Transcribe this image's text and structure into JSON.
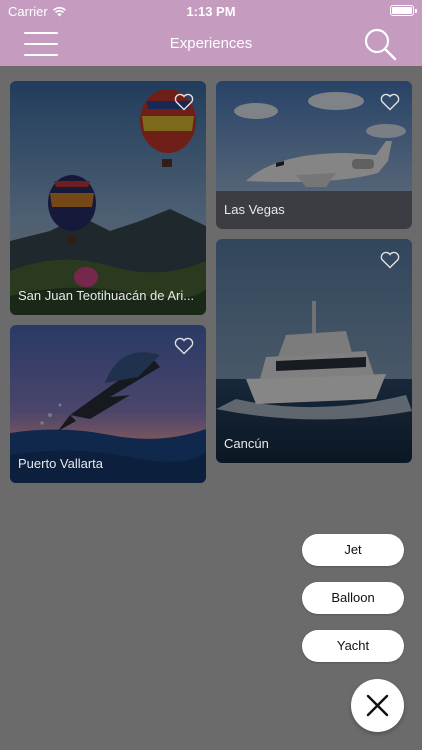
{
  "status_bar": {
    "carrier": "Carrier",
    "time": "1:13 PM"
  },
  "nav": {
    "title": "Experiences",
    "menu_icon": "hamburger-menu-icon",
    "search_icon": "search-icon"
  },
  "cards": [
    {
      "label": "San Juan Teotihuacán de Ari...",
      "image": "hot-air-balloons"
    },
    {
      "label": "Las Vegas",
      "image": "private-jet"
    },
    {
      "label": "Cancún",
      "image": "yacht"
    },
    {
      "label": "Puerto Vallarta",
      "image": "sailfish"
    }
  ],
  "filter_menu": {
    "options": [
      "Jet",
      "Balloon",
      "Yacht"
    ],
    "close_icon": "close-icon"
  },
  "colors": {
    "nav_background": "#c69bc0",
    "overlay": "#6b6b6b"
  }
}
